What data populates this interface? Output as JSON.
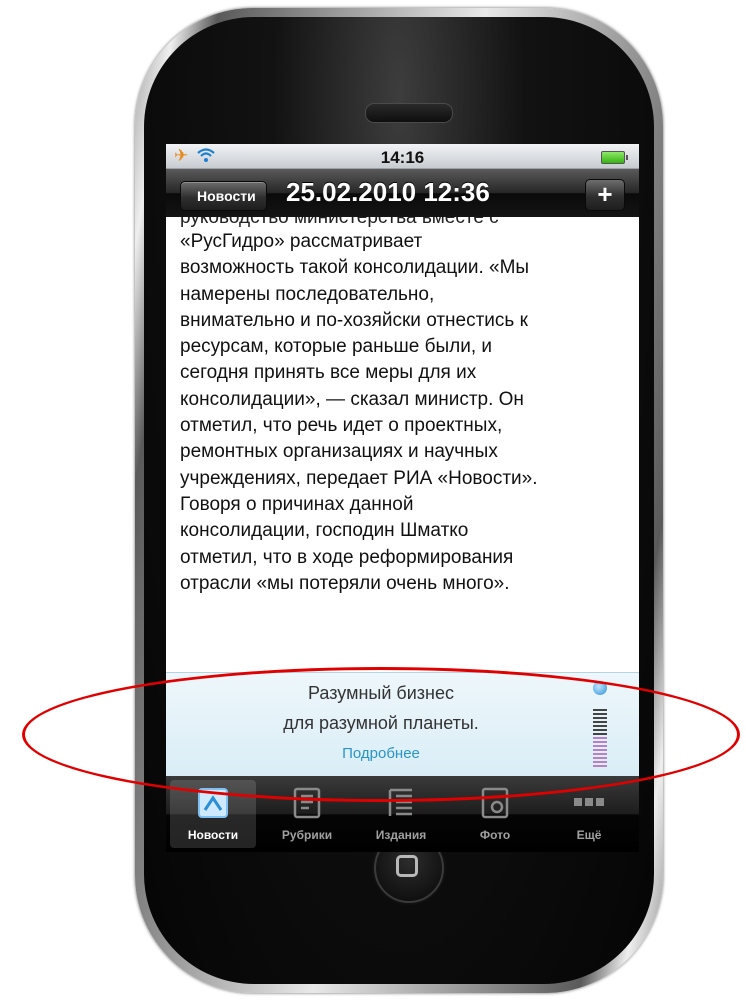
{
  "status_bar": {
    "time": "14:16"
  },
  "nav_bar": {
    "back_label": "Новости",
    "title": "25.02.2010 12:36",
    "add_label": "+"
  },
  "article": {
    "cut_line": "руководство министерства вместе с",
    "lines": [
      "«РусГидро» рассматривает",
      "возможность такой консолидации. «Мы",
      "намерены последовательно,",
      "внимательно и по-хозяйски отнестись к",
      "ресурсам, которые раньше были, и",
      "сегодня принять все меры для их",
      "консолидации», — сказал министр. Он",
      "отметил, что речь идет о проектных,",
      "ремонтных организациях и научных",
      "учреждениях, передает РИА «Новости».",
      "Говоря о причинах данной",
      "консолидации, господин Шматко",
      "отметил, что в ходе реформирования",
      "отрасли «мы потеряли очень много»."
    ]
  },
  "ad": {
    "line1": "Разумный бизнес",
    "line2": "для разумной планеты.",
    "link": "Подробнее",
    "logo": "IBM"
  },
  "tabs": [
    {
      "label": "Новости",
      "icon": "news-icon",
      "active": true
    },
    {
      "label": "Рубрики",
      "icon": "rubrics-icon",
      "active": false
    },
    {
      "label": "Издания",
      "icon": "editions-icon",
      "active": false
    },
    {
      "label": "Фото",
      "icon": "photo-icon",
      "active": false
    },
    {
      "label": "Ещё",
      "icon": "more-icon",
      "active": false
    }
  ],
  "colors": {
    "accent_link": "#2a94c8",
    "annotation": "#e00000",
    "airplane": "#e8891a"
  }
}
